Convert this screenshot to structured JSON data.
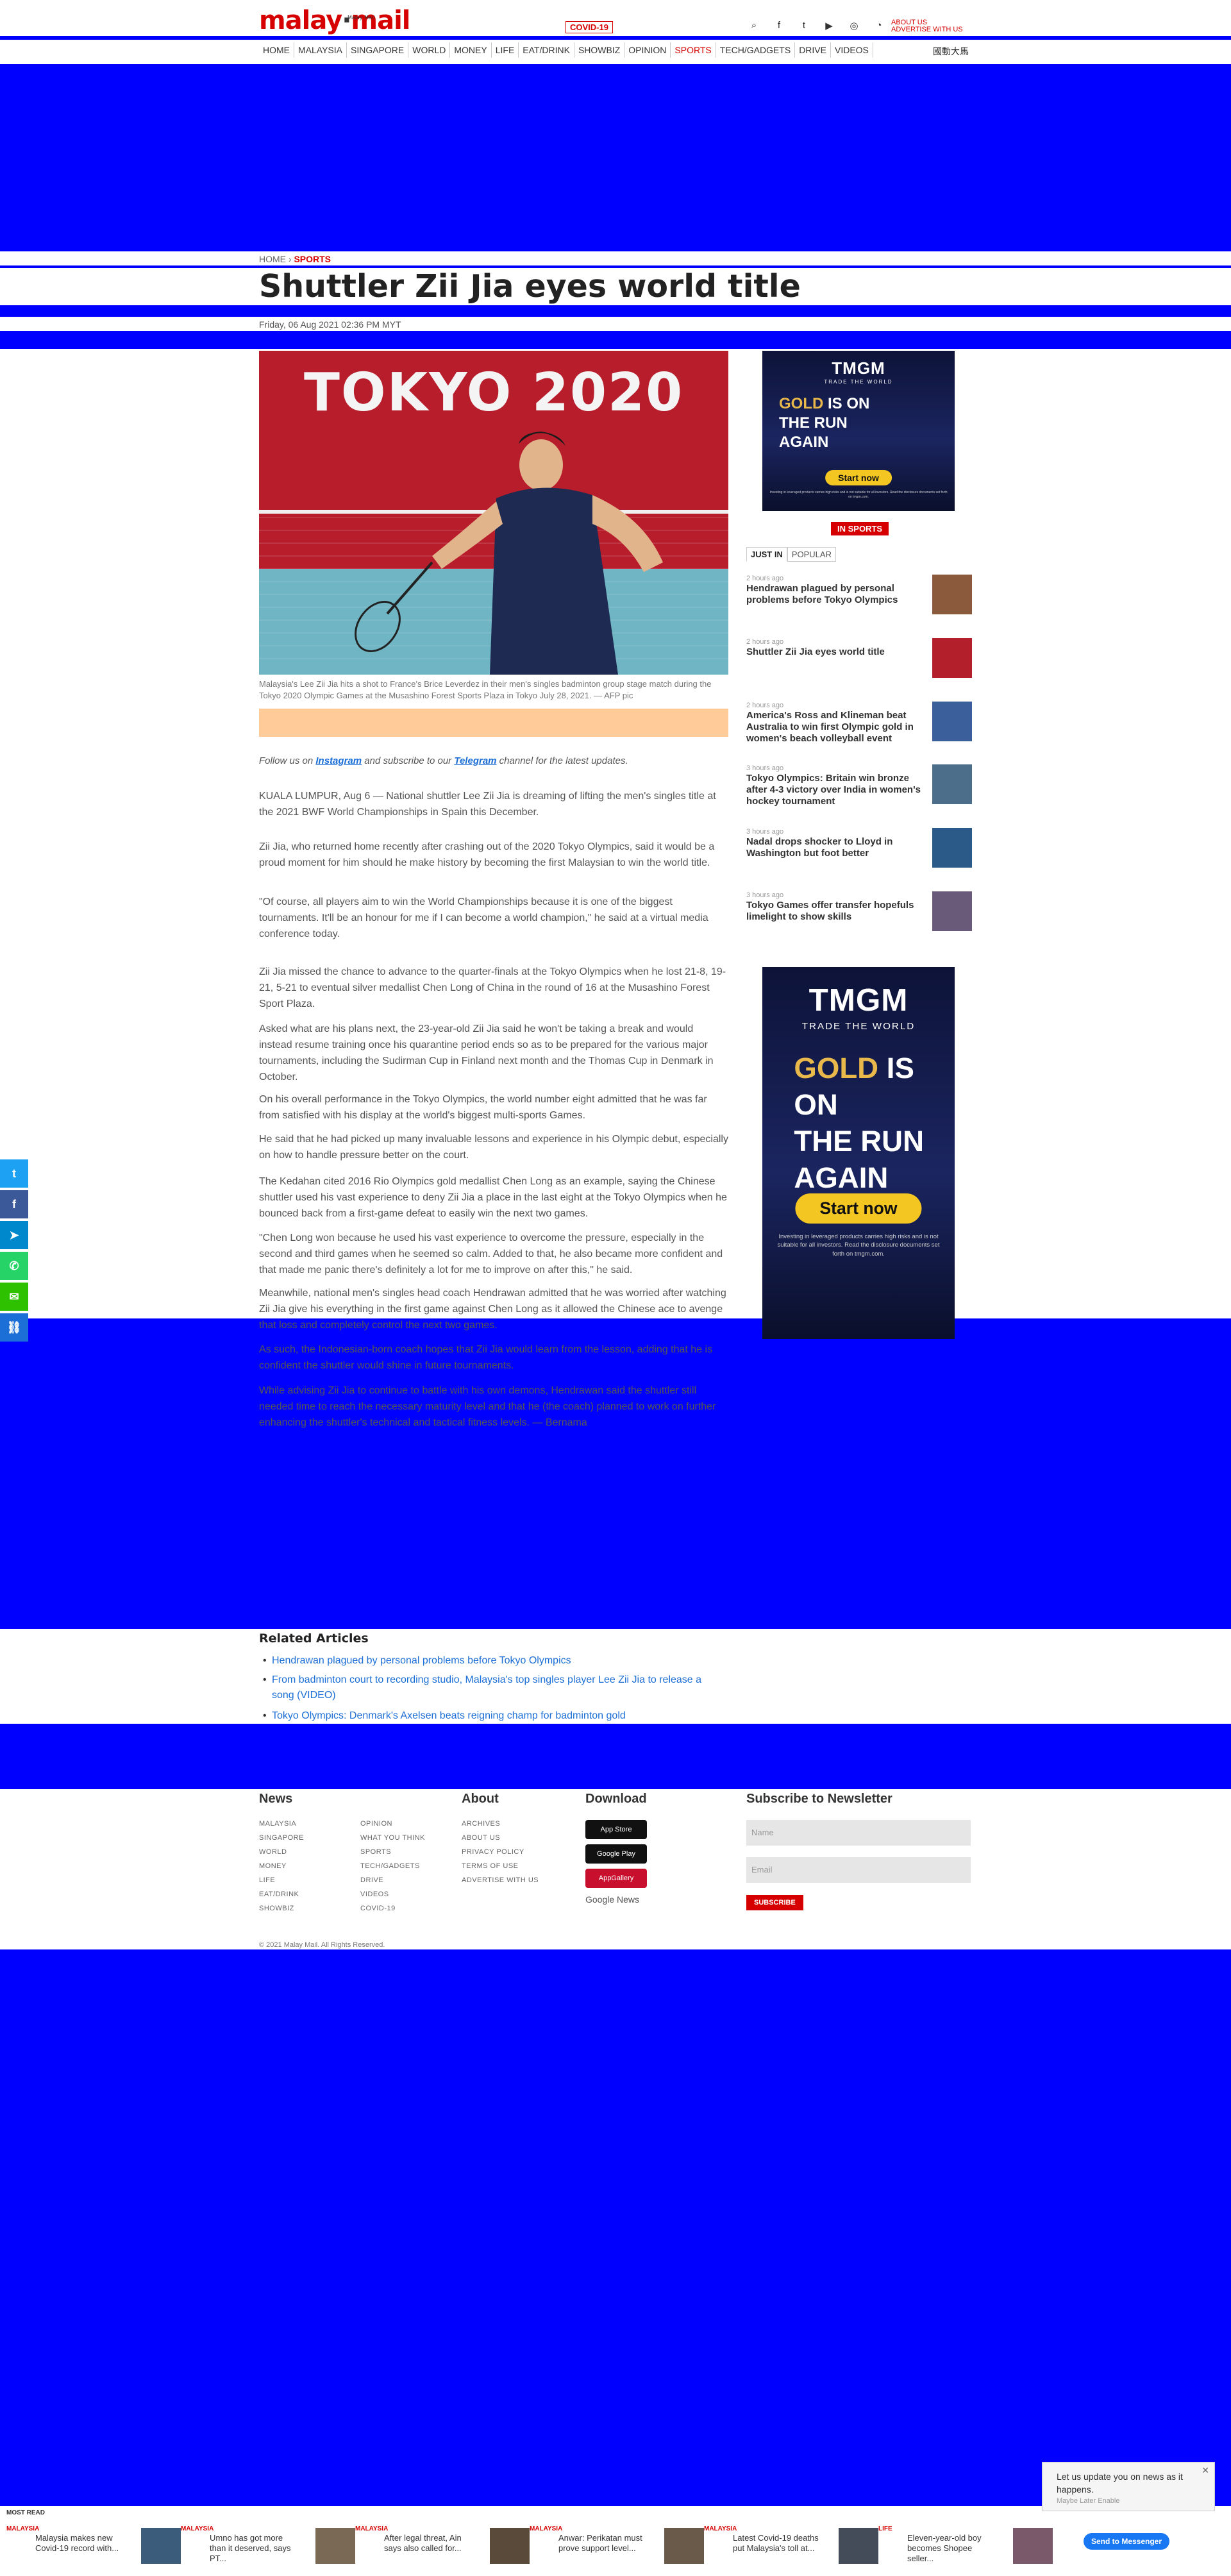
{
  "header": {
    "logo_text": "malay",
    "logo_text_2": "mail",
    "logo_tagline": "Malay Mail",
    "covid_pill": "COVID-19",
    "about_us": "ABOUT US",
    "advertise": "ADVERTISE WITH US",
    "nav_right": "國動大馬",
    "nav_items": [
      {
        "label": "HOME"
      },
      {
        "label": "MALAYSIA"
      },
      {
        "label": "SINGAPORE"
      },
      {
        "label": "WORLD"
      },
      {
        "label": "MONEY"
      },
      {
        "label": "LIFE"
      },
      {
        "label": "EAT/DRINK"
      },
      {
        "label": "SHOWBIZ"
      },
      {
        "label": "OPINION"
      },
      {
        "label": "SPORTS"
      },
      {
        "label": "TECH/GADGETS"
      },
      {
        "label": "DRIVE"
      },
      {
        "label": "VIDEOS"
      }
    ]
  },
  "article": {
    "breadcrumb_home": "HOME",
    "breadcrumb_section": "SPORTS",
    "title": "Shuttler Zii Jia eyes world title",
    "date": "Friday, 06 Aug 2021 02:36 PM MYT",
    "hero_text": "TOKYO 2020",
    "caption": "Malaysia's Lee Zii Jia hits a shot to France's Brice Leverdez in their men's singles badminton group stage match during the Tokyo 2020 Olympic Games at the Musashino Forest Sports Plaza in Tokyo July 28, 2021. — AFP pic",
    "follow_prefix": "Follow us on",
    "follow_instagram": "Instagram",
    "follow_middle": "and subscribe to our",
    "follow_telegram": "Telegram",
    "follow_suffix": "channel for the latest updates.",
    "paragraphs": [
      "KUALA LUMPUR, Aug 6 — National shuttler Lee Zii Jia is dreaming of lifting the men's singles title at the 2021 BWF World Championships in Spain this December.",
      "Zii Jia, who returned home recently after crashing out of the 2020 Tokyo Olympics, said it would be a proud moment for him should he make history by becoming the first Malaysian to win the world title.",
      "\"Of course, all players aim to win the World Championships because it is one of the biggest tournaments. It'll be an honour for me if I can become a world champion,\" he said at a virtual media conference today.",
      "Zii Jia missed the chance to advance to the quarter-finals at the Tokyo Olympics when he lost 21-8, 19-21, 5-21 to eventual silver medallist Chen Long of China in the round of 16 at the Musashino Forest Sport Plaza.",
      "Asked what are his plans next, the 23-year-old Zii Jia said he won't be taking a break and would instead resume training once his quarantine period ends so as to be prepared for the various major tournaments, including the Sudirman Cup in Finland next month and the Thomas Cup in Denmark in October.",
      "On his overall performance in the Tokyo Olympics, the world number eight admitted that he was far from satisfied with his display at the world's biggest multi-sports Games.",
      "He said that he had picked up many invaluable lessons and experience in his Olympic debut, especially on how to handle pressure better on the court.",
      "The Kedahan cited 2016 Rio Olympics gold medallist Chen Long as an example, saying the Chinese shuttler used his vast experience to deny Zii Jia a place in the last eight at the Tokyo Olympics when he bounced back from a first-game defeat to easily win the next two games.",
      "\"Chen Long won because he used his vast experience to overcome the pressure, especially in the second and third games when he seemed so calm. Added to that, he also became more confident and that made me panic there's definitely a lot for me to improve on after this,\" he said.",
      "Meanwhile, national men's singles head coach Hendrawan admitted that he was worried after watching Zii Jia give his everything in the first game against Chen Long as it allowed the Chinese ace to avenge that loss and completely control the next two games.",
      "As such, the Indonesian-born coach hopes that Zii Jia would learn from the lesson, adding that he is confident the shuttler would shine in future tournaments.",
      "While advising Zii Jia to continue to battle with his own demons, Hendrawan said the shuttler still needed time to reach the necessary maturity level and that he (the coach) planned to work on further enhancing the shuttler's technical and tactical fitness levels. — Bernama"
    ]
  },
  "sidebar": {
    "ad_brand": "TMGM",
    "ad_tagline": "TRADE THE WORLD",
    "ad_headline_1": "GOLD",
    "ad_headline_2": "IS ON",
    "ad_headline_3": "THE RUN",
    "ad_headline_4": "AGAIN",
    "ad_cta": "Start now",
    "ad_disclaimer": "Investing in leveraged products carries high risks and is not suitable for all investors. Read the disclosure documents set forth on tmgm.com.",
    "section_badge": "IN SPORTS",
    "tab_just_in": "JUST IN",
    "tab_popular": "POPULAR",
    "items": [
      {
        "time": "2 hours ago",
        "title": "Hendrawan plagued by personal problems before Tokyo Olympics"
      },
      {
        "time": "2 hours ago",
        "title": "Shuttler Zii Jia eyes world title"
      },
      {
        "time": "2 hours ago",
        "title": "America's Ross and Klineman beat Australia to win first Olympic gold in women's beach volleyball event"
      },
      {
        "time": "3 hours ago",
        "title": "Tokyo Olympics: Britain win bronze after 4-3 victory over India in women's hockey tournament"
      },
      {
        "time": "3 hours ago",
        "title": "Nadal drops shocker to Lloyd in Washington but foot better"
      },
      {
        "time": "3 hours ago",
        "title": "Tokyo Games offer transfer hopefuls limelight to show skills"
      }
    ]
  },
  "share": [
    {
      "icon": "twitter-icon",
      "glyph": "t",
      "color": "#1da1f2"
    },
    {
      "icon": "facebook-icon",
      "glyph": "f",
      "color": "#3b5998"
    },
    {
      "icon": "telegram-icon",
      "glyph": "➤",
      "color": "#0088cc"
    },
    {
      "icon": "whatsapp-icon",
      "glyph": "✆",
      "color": "#25d366"
    },
    {
      "icon": "wechat-icon",
      "glyph": "✉",
      "color": "#2dc100"
    },
    {
      "icon": "link-icon",
      "glyph": "⛓",
      "color": "#1c6fd6"
    }
  ],
  "related": {
    "title": "Related Articles",
    "items": [
      "Hendrawan plagued by personal problems before Tokyo Olympics",
      "From badminton court to recording studio, Malaysia's top singles player Lee Zii Jia to release a song (VIDEO)",
      "Tokyo Olympics: Denmark's Axelsen beats reigning champ for badminton gold"
    ]
  },
  "footer": {
    "news_title": "News",
    "about_title": "About",
    "download_title": "Download",
    "subscribe_title": "Subscribe to Newsletter",
    "news_col1": [
      "MALAYSIA",
      "SINGAPORE",
      "WORLD",
      "MONEY",
      "LIFE",
      "EAT/DRINK",
      "SHOWBIZ"
    ],
    "news_col2": [
      "OPINION",
      "WHAT YOU THINK",
      "SPORTS",
      "TECH/GADGETS",
      "DRIVE",
      "VIDEOS",
      "COVID-19"
    ],
    "about_links": [
      "ARCHIVES",
      "ABOUT US",
      "PRIVACY POLICY",
      "TERMS OF USE",
      "ADVERTISE WITH US"
    ],
    "app_store": "App Store",
    "google_play": "Google Play",
    "app_gallery": "AppGallery",
    "google_news": "Google News",
    "name_placeholder": "Name",
    "email_placeholder": "Email",
    "subscribe_button": "SUBSCRIBE",
    "copyright": "© 2021 Malay Mail. All Rights Reserved."
  },
  "popups": {
    "notif_text": "Let us update you on news as it happens.",
    "notif_option": "Maybe Later  Enable",
    "messenger": "Send to Messenger",
    "most_read": "MOST READ"
  },
  "bottom_cards": [
    {
      "section": "MALAYSIA",
      "title": "Malaysia makes new Covid-19 record with..."
    },
    {
      "section": "MALAYSIA",
      "title": "Umno has got more than it deserved, says PT..."
    },
    {
      "section": "MALAYSIA",
      "title": "After legal threat, Ain says also called for..."
    },
    {
      "section": "MALAYSIA",
      "title": "Anwar: Perikatan must prove support level..."
    },
    {
      "section": "MALAYSIA",
      "title": "Latest Covid-19 deaths put Malaysia's toll at..."
    },
    {
      "section": "LIFE",
      "title": "Eleven-year-old boy becomes Shopee seller..."
    }
  ]
}
